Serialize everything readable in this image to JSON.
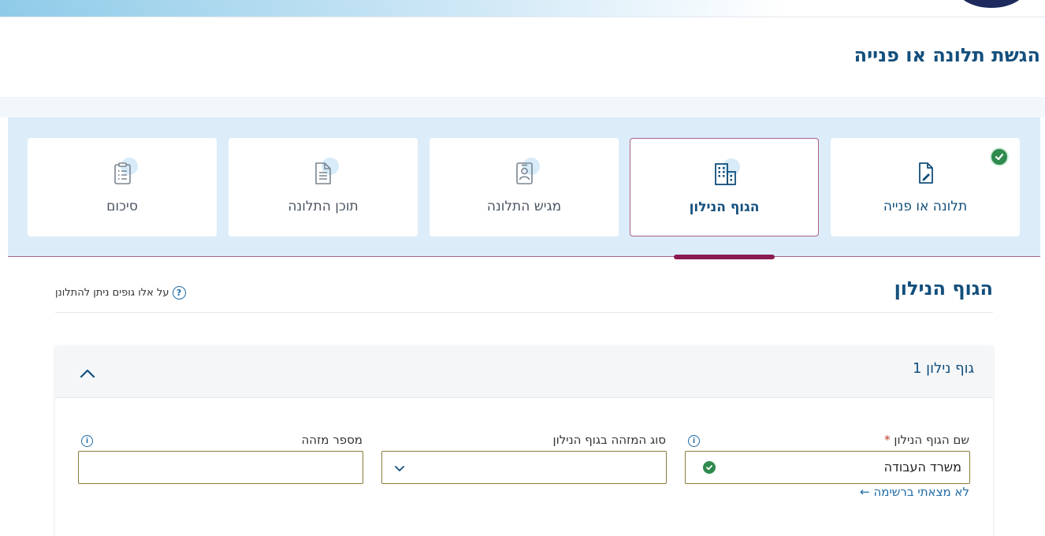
{
  "page": {
    "title": "הגשת תלונה או פנייה"
  },
  "steps": [
    {
      "label": "תלונה או פנייה",
      "state": "completed",
      "icon": "document-edit-icon"
    },
    {
      "label": "הגוף הנילון",
      "state": "active",
      "icon": "building-icon"
    },
    {
      "label": "מגיש התלונה",
      "state": "pending",
      "icon": "id-badge-icon"
    },
    {
      "label": "תוכן התלונה",
      "state": "pending",
      "icon": "document-lines-icon"
    },
    {
      "label": "סיכום",
      "state": "pending",
      "icon": "clipboard-list-icon"
    }
  ],
  "section": {
    "title": "הגוף הנילון",
    "help_link": "על אלו גופים ניתן להתלונן",
    "help_icon": "question-circle-icon"
  },
  "panel": {
    "title": "גוף נילון 1",
    "expanded": true
  },
  "form": {
    "body_name": {
      "label": "שם הגוף הנילון",
      "required_mark": "*",
      "value": "משרד העבודה",
      "valid": true
    },
    "id_type": {
      "label": "סוג המזהה בגוף הנילון",
      "value": ""
    },
    "id_number": {
      "label": "מספר מזהה",
      "value": ""
    },
    "not_found_link": "לא מצאתי ברשימה ←"
  },
  "colors": {
    "primary": "#134f7c",
    "accent": "#8a1c52",
    "success": "#2f8a4e",
    "steps_background": "#dcedf9"
  }
}
